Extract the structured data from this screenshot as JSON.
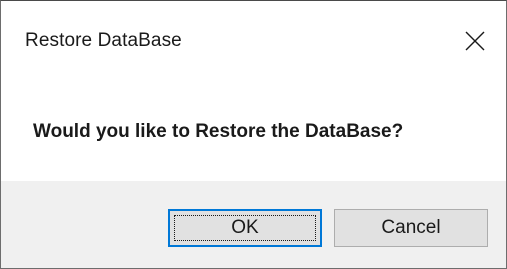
{
  "window": {
    "title": "Restore DataBase",
    "close_icon": "close-icon"
  },
  "message": {
    "text": "Would you like to Restore the DataBase?"
  },
  "buttons": {
    "ok_label": "OK",
    "cancel_label": "Cancel"
  },
  "colors": {
    "footer_background": "#f0f0f0",
    "button_background": "#e1e1e1",
    "default_button_border": "#0078d7"
  }
}
